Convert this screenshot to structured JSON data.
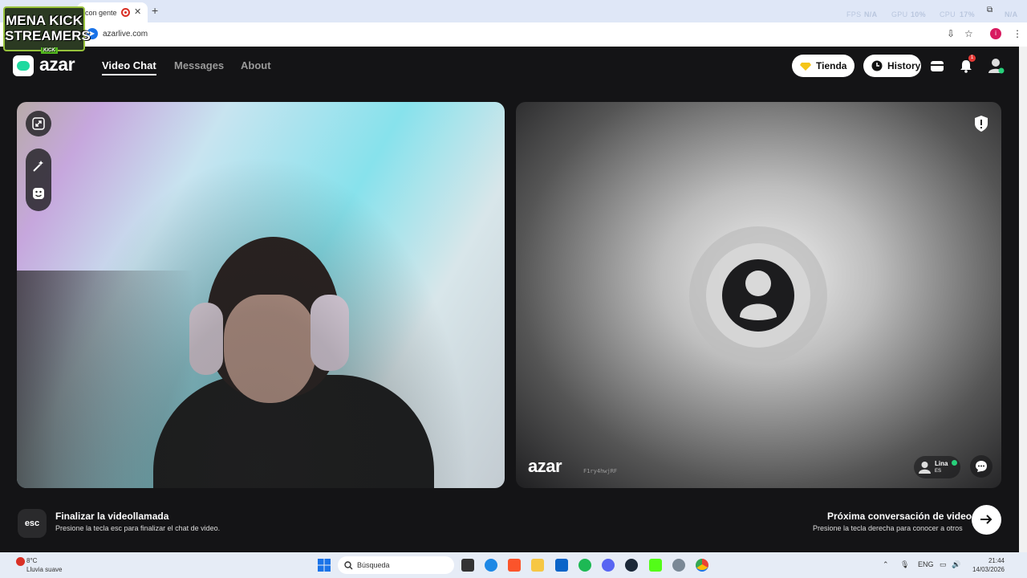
{
  "browser": {
    "tab_title": "con gente",
    "new_tab": "+",
    "url": "azarlive.com",
    "perf": {
      "fps_label": "FPS",
      "fps_val": "N/A",
      "gpu_label": "GPU",
      "gpu_val": "10%",
      "cpu_label": "CPU",
      "cpu_val": "17%",
      "extra": "N/A"
    },
    "profile_initial": "i"
  },
  "watermark": {
    "line1": "MENA KICK",
    "line2": "STREAMERS",
    "badge": "KICK"
  },
  "app": {
    "logo": "azar",
    "nav": {
      "video_chat": "Video Chat",
      "messages": "Messages",
      "about": "About"
    },
    "store_label": "Tienda",
    "history_label": "History",
    "notif_count": "1"
  },
  "remote": {
    "logo": "azar",
    "id": "F1ry4hwjRF",
    "user_name": "Lina",
    "user_country": "ES"
  },
  "footer": {
    "esc_key": "esc",
    "end_title": "Finalizar la videollamada",
    "end_sub": "Presione la tecla esc para finalizar el chat de video.",
    "next_title": "Próxima conversación de video",
    "next_sub": "Presione la tecla derecha para conocer a otros"
  },
  "taskbar": {
    "weather_temp": "8°C",
    "weather_desc": "Lluvia suave",
    "search_placeholder": "Búsqueda",
    "lang": "ENG",
    "time": "21:44",
    "date": "14/03/2026"
  },
  "colors": {
    "brand": "#1fd99f",
    "store_gem": "#f5c518",
    "status": "#27d07a"
  }
}
